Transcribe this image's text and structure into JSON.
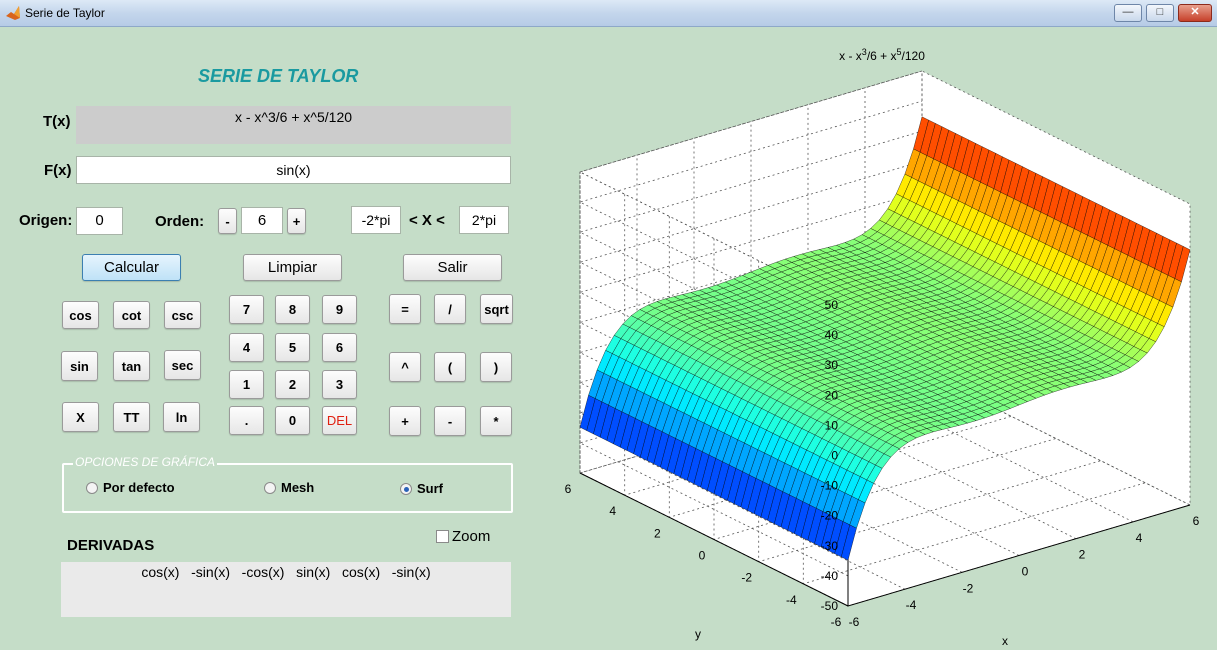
{
  "window": {
    "title": "Serie de Taylor"
  },
  "app": {
    "title": "SERIE DE TAYLOR"
  },
  "taylor": {
    "label": "T(x)",
    "value": "x - x^3/6 + x^5/120"
  },
  "function": {
    "label": "F(x)",
    "value": "sin(x)"
  },
  "origin": {
    "label": "Origen:",
    "value": "0"
  },
  "order": {
    "label": "Orden:",
    "minus": "-",
    "value": "6",
    "plus": "+"
  },
  "range": {
    "min": "-2*pi",
    "label": "< X <",
    "max": "2*pi"
  },
  "actions": {
    "calculate": "Calcular",
    "clear": "Limpiar",
    "exit": "Salir"
  },
  "keys": {
    "trig": [
      "cos",
      "cot",
      "csc",
      "sin",
      "tan",
      "sec",
      "X",
      "TT",
      "ln"
    ],
    "digits": [
      "7",
      "8",
      "9",
      "4",
      "5",
      "6",
      "1",
      "2",
      "3",
      ".",
      "0",
      "DEL"
    ],
    "ops": [
      "=",
      "/",
      "sqrt",
      "^",
      "(",
      ")",
      "+",
      "-",
      "*"
    ]
  },
  "plot_options": {
    "title": "OPCIONES DE GRÁFICA",
    "options": [
      "Por defecto",
      "Mesh",
      "Surf"
    ],
    "selected": "Surf"
  },
  "zoom": {
    "label": "Zoom",
    "checked": false
  },
  "derivatives": {
    "label": "DERIVADAS",
    "values": "cos(x)   -sin(x)   -cos(x)   sin(x)   cos(x)   -sin(x)"
  },
  "colors": {
    "title": "#1a9aa0",
    "del_key": "#e02010",
    "background": "#c5ddc8"
  },
  "chart_data": {
    "type": "surface",
    "title": "x - x^3/6 + x^5/120",
    "function": "x - x^3/6 + x^5/120",
    "xlabel": "x",
    "ylabel": "y",
    "zlabel": "",
    "xlim": [
      -6,
      6
    ],
    "ylim": [
      -6,
      6
    ],
    "zlim": [
      -50,
      50
    ],
    "xticks": [
      -6,
      -4,
      -2,
      0,
      2,
      4,
      6
    ],
    "yticks": [
      -6,
      -4,
      -2,
      0,
      2,
      4,
      6
    ],
    "zticks": [
      -50,
      -40,
      -30,
      -20,
      -10,
      0,
      10,
      20,
      30,
      40,
      50
    ],
    "colormap": "jet",
    "grid": true
  }
}
